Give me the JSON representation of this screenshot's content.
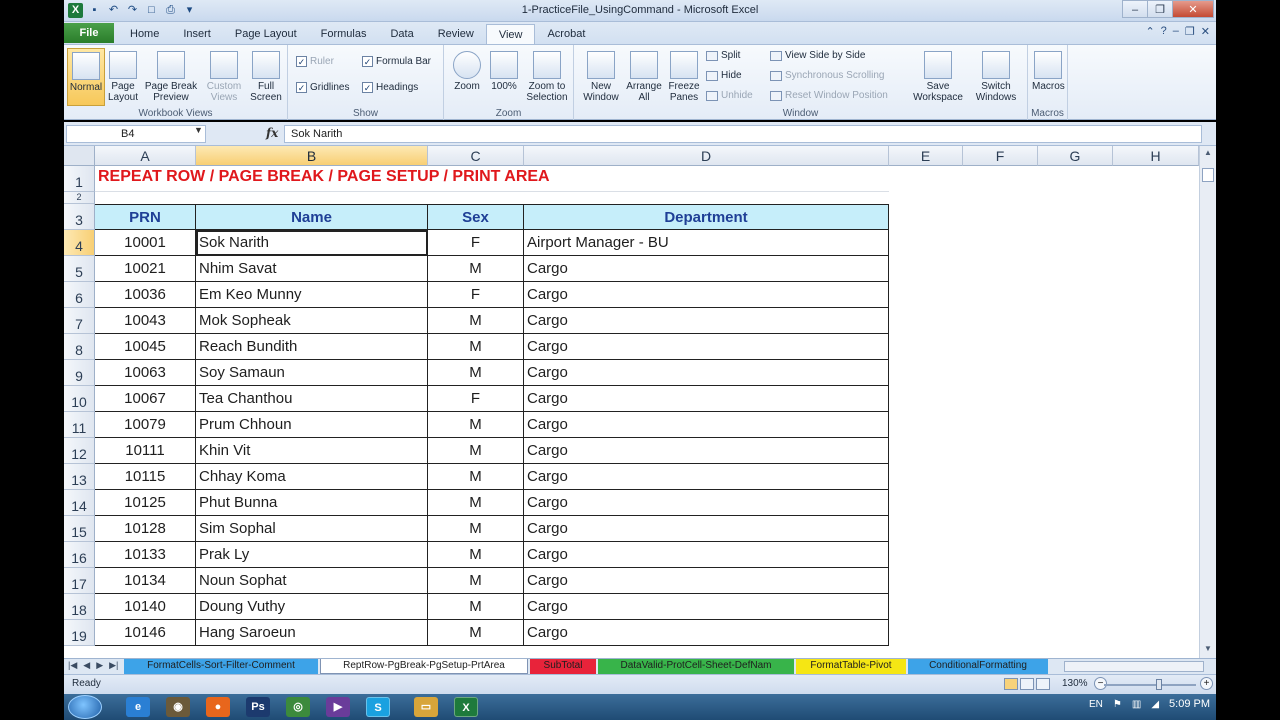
{
  "window": {
    "title": "1-PracticeFile_UsingCommand  -  Microsoft Excel"
  },
  "ribbon": {
    "file_tab": "File",
    "tabs": [
      "Home",
      "Insert",
      "Page Layout",
      "Formulas",
      "Data",
      "Review",
      "View",
      "Acrobat"
    ],
    "active_tab": "View",
    "groups": {
      "workbook_views": {
        "label": "Workbook Views",
        "buttons": {
          "normal": "Normal",
          "page_layout": "Page Layout",
          "page_break": "Page Break Preview",
          "custom_views": "Custom Views",
          "full_screen": "Full Screen"
        }
      },
      "show": {
        "label": "Show",
        "ruler": "Ruler",
        "formula_bar": "Formula Bar",
        "gridlines": "Gridlines",
        "headings": "Headings"
      },
      "zoom": {
        "label": "Zoom",
        "zoom": "Zoom",
        "hundred": "100%",
        "zoom_selection": "Zoom to Selection"
      },
      "window": {
        "label": "Window",
        "new_window": "New Window",
        "arrange_all": "Arrange All",
        "freeze_panes": "Freeze Panes",
        "split": "Split",
        "hide": "Hide",
        "unhide": "Unhide",
        "side_by_side": "View Side by Side",
        "sync_scroll": "Synchronous Scrolling",
        "reset_pos": "Reset Window Position",
        "save_workspace": "Save Workspace",
        "switch_windows": "Switch Windows"
      },
      "macros": {
        "label": "Macros",
        "macros": "Macros"
      }
    }
  },
  "formula_bar": {
    "name_box": "B4",
    "fx": "fx",
    "content": "Sok Narith"
  },
  "grid": {
    "columns": [
      "A",
      "B",
      "C",
      "D",
      "E",
      "F",
      "G",
      "H"
    ],
    "title": "REPEAT ROW / PAGE BREAK / PAGE SETUP / PRINT AREA",
    "headers": [
      "PRN",
      "Name",
      "Sex",
      "Department"
    ],
    "row_numbers": [
      "1",
      "2",
      "3",
      "4",
      "5",
      "6",
      "7",
      "8",
      "9",
      "10",
      "11",
      "12",
      "13",
      "14",
      "15",
      "16",
      "17",
      "18",
      "19"
    ],
    "rows": [
      {
        "prn": "10001",
        "name": "Sok Narith",
        "sex": "F",
        "dept": "Airport Manager - BU"
      },
      {
        "prn": "10021",
        "name": "Nhim Savat",
        "sex": "M",
        "dept": "Cargo"
      },
      {
        "prn": "10036",
        "name": "Em Keo Munny",
        "sex": "F",
        "dept": "Cargo"
      },
      {
        "prn": "10043",
        "name": "Mok Sopheak",
        "sex": "M",
        "dept": "Cargo"
      },
      {
        "prn": "10045",
        "name": "Reach Bundith",
        "sex": "M",
        "dept": "Cargo"
      },
      {
        "prn": "10063",
        "name": "Soy Samaun",
        "sex": "M",
        "dept": "Cargo"
      },
      {
        "prn": "10067",
        "name": "Tea Chanthou",
        "sex": "F",
        "dept": "Cargo"
      },
      {
        "prn": "10079",
        "name": "Prum Chhoun",
        "sex": "M",
        "dept": "Cargo"
      },
      {
        "prn": "10111",
        "name": "Khin Vit",
        "sex": "M",
        "dept": "Cargo"
      },
      {
        "prn": "10115",
        "name": "Chhay Koma",
        "sex": "M",
        "dept": "Cargo"
      },
      {
        "prn": "10125",
        "name": "Phut Bunna",
        "sex": "M",
        "dept": "Cargo"
      },
      {
        "prn": "10128",
        "name": "Sim Sophal",
        "sex": "M",
        "dept": "Cargo"
      },
      {
        "prn": "10133",
        "name": "Prak Ly",
        "sex": "M",
        "dept": "Cargo"
      },
      {
        "prn": "10134",
        "name": "Noun Sophat",
        "sex": "M",
        "dept": "Cargo"
      },
      {
        "prn": "10140",
        "name": "Doung Vuthy",
        "sex": "M",
        "dept": "Cargo"
      },
      {
        "prn": "10146",
        "name": "Hang Saroeun",
        "sex": "M",
        "dept": "Cargo"
      }
    ],
    "selected_cell": "B4"
  },
  "sheet_tabs": [
    {
      "label": "FormatCells-Sort-Filter-Comment",
      "color": "#3da3e8"
    },
    {
      "label": "ReptRow-PgBreak-PgSetup-PrtArea",
      "color": "#ffffff",
      "active": true
    },
    {
      "label": "SubTotal",
      "color": "#e8233a"
    },
    {
      "label": "DataValid-ProtCell-Sheet-DefNam",
      "color": "#38b44a"
    },
    {
      "label": "FormatTable-Pivot",
      "color": "#f5e614"
    },
    {
      "label": "ConditionalFormatting",
      "color": "#3da3e8"
    }
  ],
  "status": {
    "ready": "Ready",
    "zoom": "130%"
  },
  "taskbar": {
    "lang": "EN",
    "time": "5:09 PM"
  },
  "colors": {
    "title_red": "#e0181c",
    "header_fill": "#c6eefa",
    "header_text": "#1f3f96",
    "excel_green": "#2a7d2a"
  }
}
